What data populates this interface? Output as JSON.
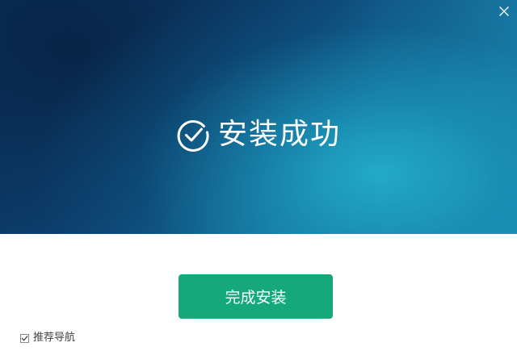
{
  "window": {
    "close_icon": "close-icon",
    "accent_color": "#14a87a"
  },
  "banner": {
    "status_icon": "check-circle-icon",
    "title": "安装成功"
  },
  "actions": {
    "finish_label": "完成安装"
  },
  "options": {
    "recommend_nav": {
      "label": "推荐导航",
      "checked": true
    }
  }
}
